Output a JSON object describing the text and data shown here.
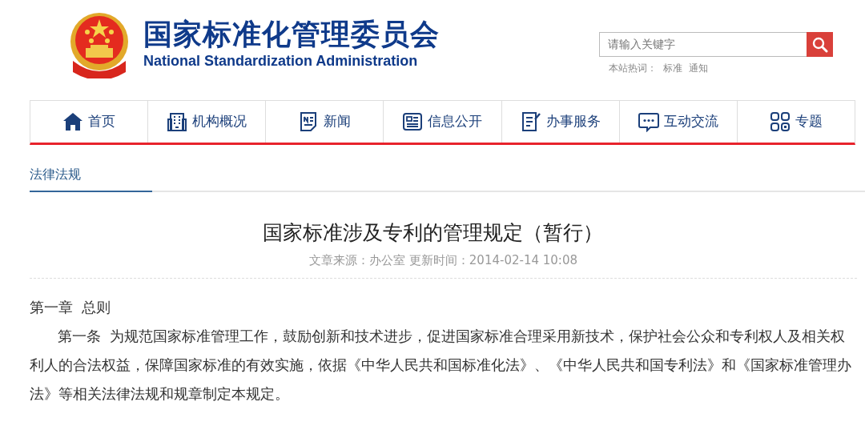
{
  "header": {
    "title_cn": "国家标准化管理委员会",
    "title_en": "National Standardization Administration"
  },
  "search": {
    "placeholder": "请输入关键字",
    "hot_label": "本站热词：",
    "hot_words": [
      "标准",
      "通知"
    ]
  },
  "nav": [
    {
      "label": "首页"
    },
    {
      "label": "机构概况"
    },
    {
      "label": "新闻"
    },
    {
      "label": "信息公开"
    },
    {
      "label": "办事服务"
    },
    {
      "label": "互动交流"
    },
    {
      "label": "专题"
    }
  ],
  "section_tab": {
    "label": "法律法规",
    "selected": true
  },
  "article": {
    "title": "国家标准涉及专利的管理规定（暂行）",
    "meta": "文章来源：办公室 更新时间：2014-02-14 10:08",
    "chapter": "第一章  总则",
    "paragraphs": [
      "第一条  为规范国家标准管理工作，鼓励创新和技术进步，促进国家标准合理采用新技术，保护社会公众和专利权人及相关权利人的合法权益，保障国家标准的有效实施，依据《中华人民共和国标准化法》、《中华人民共和国专利法》和《国家标准管理办法》等相关法律法规和规章制定本规定。"
    ]
  }
}
